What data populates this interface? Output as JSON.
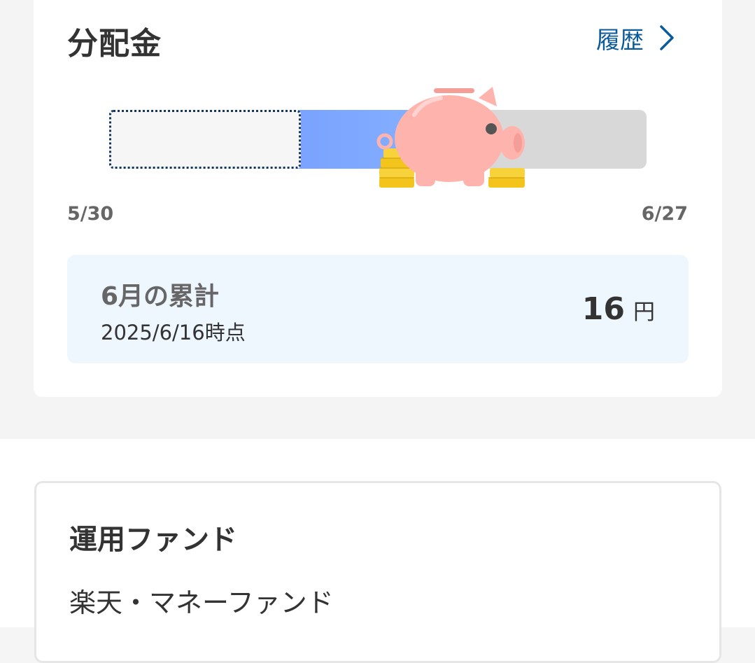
{
  "dividend": {
    "title": "分配金",
    "history_link": "履歴",
    "progress": {
      "start_label": "5/30",
      "end_label": "6/27",
      "fill_fraction": 0.61
    },
    "monthly_total": {
      "title": "6月の累計",
      "as_of": "2025/6/16時点",
      "amount": "16",
      "unit": "円"
    }
  },
  "fund_section": {
    "heading": "運用ファンド",
    "fund_name": "楽天・マネーファンド"
  },
  "colors": {
    "accent_link": "#0b5a9a",
    "progress_gradient_start": "#8fd6ff",
    "progress_gradient_end": "#84b0ff",
    "pig": "#ffb3ad"
  },
  "icons": [
    "chevron-right-icon",
    "piggy-bank-icon",
    "coin-stack-icon"
  ]
}
